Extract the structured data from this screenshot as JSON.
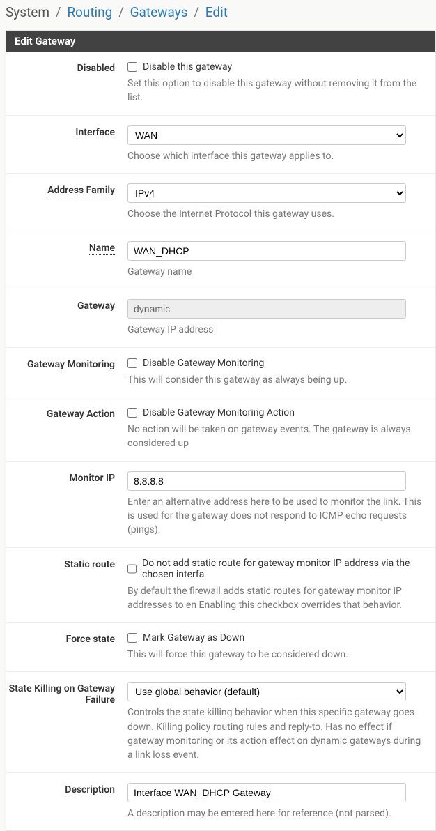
{
  "breadcrumb": {
    "root": "System",
    "items": [
      "Routing",
      "Gateways",
      "Edit"
    ]
  },
  "panel": {
    "title": "Edit Gateway"
  },
  "fields": {
    "disabled": {
      "label": "Disabled",
      "checkbox_label": "Disable this gateway",
      "help": "Set this option to disable this gateway without removing it from the list."
    },
    "interface": {
      "label": "Interface",
      "value": "WAN",
      "help": "Choose which interface this gateway applies to."
    },
    "address_family": {
      "label": "Address Family",
      "value": "IPv4",
      "help": "Choose the Internet Protocol this gateway uses."
    },
    "name": {
      "label": "Name",
      "value": "WAN_DHCP",
      "help": "Gateway name"
    },
    "gateway": {
      "label": "Gateway",
      "value": "dynamic",
      "help": "Gateway IP address"
    },
    "monitoring": {
      "label": "Gateway Monitoring",
      "checkbox_label": "Disable Gateway Monitoring",
      "help": "This will consider this gateway as always being up."
    },
    "action": {
      "label": "Gateway Action",
      "checkbox_label": "Disable Gateway Monitoring Action",
      "help": "No action will be taken on gateway events. The gateway is always considered up"
    },
    "monitor_ip": {
      "label": "Monitor IP",
      "value": "8.8.8.8",
      "help": "Enter an alternative address here to be used to monitor the link. This is used for the gateway does not respond to ICMP echo requests (pings)."
    },
    "static_route": {
      "label": "Static route",
      "checkbox_label": "Do not add static route for gateway monitor IP address via the chosen interfa",
      "help": "By default the firewall adds static routes for gateway monitor IP addresses to en Enabling this checkbox overrides that behavior."
    },
    "force_state": {
      "label": "Force state",
      "checkbox_label": "Mark Gateway as Down",
      "help": "This will force this gateway to be considered down."
    },
    "state_killing": {
      "label": "State Killing on Gateway Failure",
      "value": "Use global behavior (default)",
      "help": "Controls the state killing behavior when this specific gateway goes down. Killing policy routing rules and reply-to. Has no effect if gateway monitoring or its action effect on dynamic gateways during a link loss event."
    },
    "description": {
      "label": "Description",
      "value": "Interface WAN_DHCP Gateway",
      "help": "A description may be entered here for reference (not parsed)."
    }
  }
}
